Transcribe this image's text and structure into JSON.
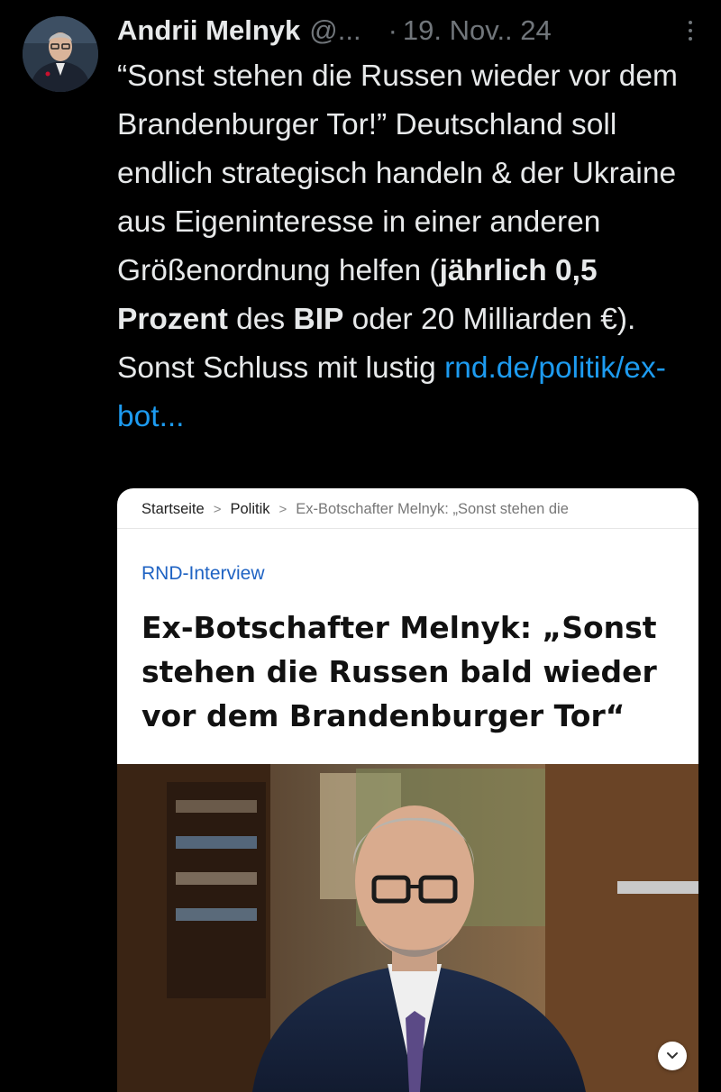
{
  "tweet": {
    "author_name": "Andrii Melnyk",
    "author_handle": "@...",
    "separator": "·",
    "date": "19. Nov.. 24",
    "text_1": "“Sonst stehen die Russen wieder vor dem Brandenburger Tor!” Deutschland soll endlich strategisch handeln & der Ukraine aus Eigeninteresse in einer anderen Größenordnung helfen (",
    "text_bold_1": "jährlich 0,5 Prozent",
    "text_2": " des ",
    "text_bold_2": "BIP",
    "text_3": " oder 20 Milliarden €). Sonst Schluss mit lustig ",
    "link": "rnd.de/politik/ex-bot..."
  },
  "card": {
    "breadcrumb": [
      "Startseite",
      "Politik",
      "Ex-Botschafter Melnyk: „Sonst stehen die"
    ],
    "breadcrumb_separator": ">",
    "kicker": "RND-Interview",
    "headline": "Ex-Botschafter Melnyk: „Sonst stehen die Russen bald wieder vor dem Brandenburger Tor“"
  },
  "icons": {
    "more": "more-options-icon",
    "expand": "chevron-down-icon"
  },
  "colors": {
    "background": "#000000",
    "text": "#e7e9ea",
    "muted": "#71767b",
    "link": "#1d9bf0",
    "kicker": "#1f63c3"
  }
}
